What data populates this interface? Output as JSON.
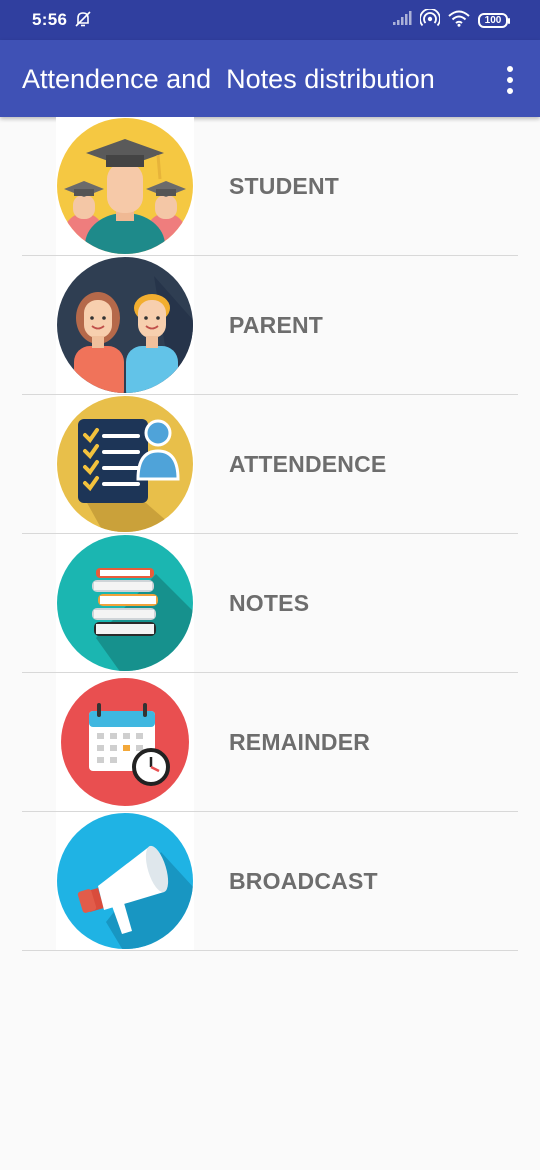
{
  "status_bar": {
    "time": "5:56",
    "battery": "100"
  },
  "app_bar": {
    "title": "Attendence and  Notes distribution"
  },
  "menu": [
    {
      "label": "STUDENT",
      "icon": "graduates-icon"
    },
    {
      "label": "PARENT",
      "icon": "parents-icon"
    },
    {
      "label": "ATTENDENCE",
      "icon": "attendance-checklist-icon"
    },
    {
      "label": "NOTES",
      "icon": "books-stack-icon"
    },
    {
      "label": "REMAINDER",
      "icon": "calendar-clock-icon"
    },
    {
      "label": "BROADCAST",
      "icon": "megaphone-icon"
    }
  ],
  "colors": {
    "status_bar": "#303f9f",
    "app_bar": "#3f51b5",
    "label_text": "#6d6d6d",
    "divider": "#d8d8d8"
  }
}
